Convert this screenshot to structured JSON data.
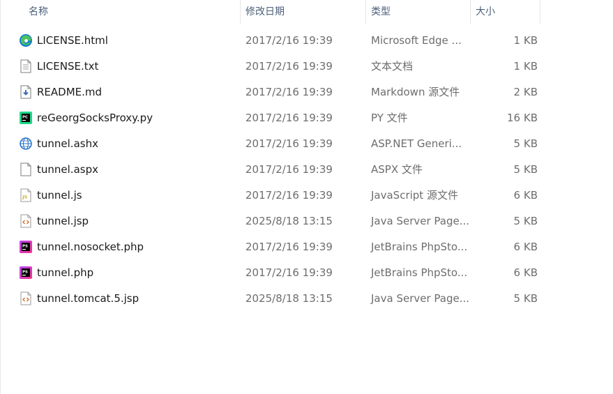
{
  "columns": {
    "name": "名称",
    "date": "修改日期",
    "type": "类型",
    "size": "大小",
    "sort_indicator": "^"
  },
  "files": [
    {
      "icon": "edge-icon",
      "name": "LICENSE.html",
      "date": "2017/2/16 19:39",
      "type": "Microsoft Edge ...",
      "size": "1 KB"
    },
    {
      "icon": "text-file-icon",
      "name": "LICENSE.txt",
      "date": "2017/2/16 19:39",
      "type": "文本文档",
      "size": "1 KB"
    },
    {
      "icon": "markdown-file-icon",
      "name": "README.md",
      "date": "2017/2/16 19:39",
      "type": "Markdown 源文件",
      "size": "2 KB"
    },
    {
      "icon": "pycharm-icon",
      "name": "reGeorgSocksProxy.py",
      "date": "2017/2/16 19:39",
      "type": "PY 文件",
      "size": "16 KB"
    },
    {
      "icon": "web-globe-icon",
      "name": "tunnel.ashx",
      "date": "2017/2/16 19:39",
      "type": "ASP.NET Generi...",
      "size": "5 KB"
    },
    {
      "icon": "blank-file-icon",
      "name": "tunnel.aspx",
      "date": "2017/2/16 19:39",
      "type": "ASPX 文件",
      "size": "5 KB"
    },
    {
      "icon": "javascript-file-icon",
      "name": "tunnel.js",
      "date": "2017/2/16 19:39",
      "type": "JavaScript 源文件",
      "size": "6 KB"
    },
    {
      "icon": "code-file-icon",
      "name": "tunnel.jsp",
      "date": "2025/8/18 13:15",
      "type": "Java Server Page...",
      "size": "5 KB"
    },
    {
      "icon": "phpstorm-icon",
      "name": "tunnel.nosocket.php",
      "date": "2017/2/16 19:39",
      "type": "JetBrains PhpSto...",
      "size": "6 KB"
    },
    {
      "icon": "phpstorm-icon",
      "name": "tunnel.php",
      "date": "2017/2/16 19:39",
      "type": "JetBrains PhpSto...",
      "size": "6 KB"
    },
    {
      "icon": "code-file-icon",
      "name": "tunnel.tomcat.5.jsp",
      "date": "2025/8/18 13:15",
      "type": "Java Server Page...",
      "size": "5 KB"
    }
  ],
  "colors": {
    "header_text": "#4c607a",
    "secondary_text": "#6d6d6d",
    "edge_blue": "#0c7bd6",
    "edge_green": "#4ec35b",
    "pycharm_green": "#21d789",
    "phpstorm_purple": "#b345f1",
    "phpstorm_pink": "#ff318c",
    "js_yellow": "#c9b22a",
    "code_orange": "#d46a2a"
  }
}
